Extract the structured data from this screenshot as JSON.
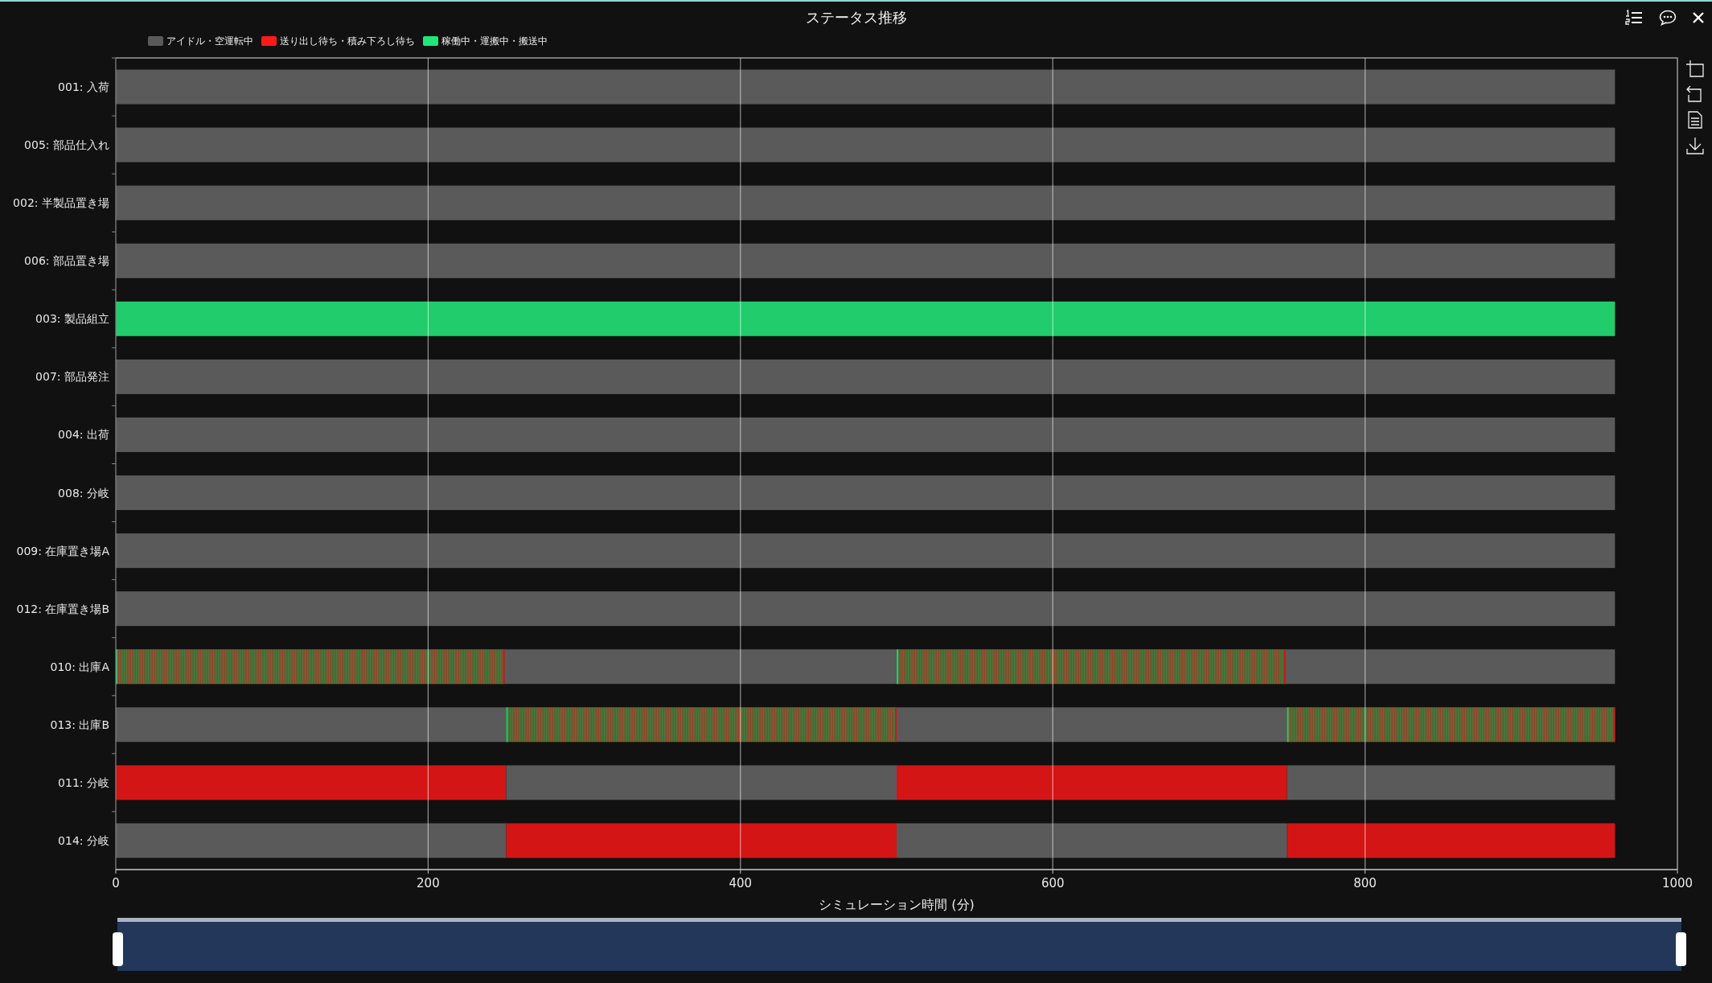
{
  "legend": [
    {
      "label": "アイドル・空運転中",
      "color": "#5a5a5a"
    },
    {
      "label": "送り出し待ち・積み下ろし待ち",
      "color": "#ff1a1a"
    },
    {
      "label": "稼働中・運搬中・搬送中",
      "color": "#1ee87a"
    }
  ],
  "chart": {
    "chart_data": {
      "type": "bar",
      "orientation": "horizontal",
      "stacked": true,
      "grid": true,
      "title": "ステータス推移",
      "xlabel": "シミュレーション時間 (分)",
      "xlim": [
        0,
        1000
      ],
      "xticks": [
        0,
        200,
        400,
        600,
        800,
        1000
      ],
      "categories": [
        "001: 入荷",
        "005: 部品仕入れ",
        "002: 半製品置き場",
        "006: 部品置き場",
        "003: 製品組立",
        "007: 部品発注",
        "004: 出荷",
        "008: 分岐",
        "009: 在庫置き場A",
        "012: 在庫置き場B",
        "010: 出庫A",
        "013: 出庫B",
        "011: 分岐",
        "014: 分岐"
      ],
      "series": [
        {
          "values": [
            960,
            960,
            960,
            960,
            960,
            960,
            960,
            960,
            960,
            960,
            249,
            250,
            250,
            250
          ],
          "colors": [
            "#5a5a5a",
            "#5a5a5a",
            "#5a5a5a",
            "#5a5a5a",
            "#20cc6b",
            "#5a5a5a",
            "#5a5a5a",
            "#5a5a5a",
            "#5a5a5a",
            "#5a5a5a",
            "#5f5b2c",
            "#5a5a5a",
            "#d41515",
            "#5a5a5a"
          ]
        },
        {
          "values": [
            null,
            null,
            null,
            null,
            null,
            null,
            null,
            null,
            null,
            null,
            251,
            250,
            250,
            250
          ],
          "colors": [
            null,
            null,
            null,
            null,
            null,
            null,
            null,
            null,
            null,
            null,
            "#5a5a5a",
            "#5f5b2c",
            "#5a5a5a",
            "#d41515"
          ]
        },
        {
          "values": [
            null,
            null,
            null,
            null,
            null,
            null,
            null,
            null,
            null,
            null,
            249,
            250,
            250,
            250
          ],
          "colors": [
            null,
            null,
            null,
            null,
            null,
            null,
            null,
            null,
            null,
            null,
            "#5f5b2c",
            "#5a5a5a",
            "#d41515",
            "#5a5a5a"
          ]
        },
        {
          "values": [
            null,
            null,
            null,
            null,
            null,
            null,
            null,
            null,
            null,
            null,
            211,
            210,
            210,
            210
          ],
          "colors": [
            null,
            null,
            null,
            null,
            null,
            null,
            null,
            null,
            null,
            null,
            "#5a5a5a",
            "#5f5b2c",
            "#5a5a5a",
            "#d41515"
          ]
        }
      ]
    },
    "rows": [
      {
        "segments": [
          {
            "kind": "idle"
          }
        ]
      },
      {
        "segments": [
          {
            "kind": "idle"
          }
        ]
      },
      {
        "segments": [
          {
            "kind": "idle"
          }
        ]
      },
      {
        "segments": [
          {
            "kind": "idle"
          }
        ]
      },
      {
        "segments": [
          {
            "kind": "working"
          }
        ]
      },
      {
        "segments": [
          {
            "kind": "idle"
          }
        ]
      },
      {
        "segments": [
          {
            "kind": "idle"
          }
        ]
      },
      {
        "segments": [
          {
            "kind": "idle"
          }
        ]
      },
      {
        "segments": [
          {
            "kind": "idle"
          }
        ]
      },
      {
        "segments": [
          {
            "kind": "idle"
          }
        ]
      },
      {
        "segments": [
          {
            "kind": "mixed"
          },
          {
            "kind": "idle"
          },
          {
            "kind": "mixed"
          },
          {
            "kind": "idle"
          }
        ]
      },
      {
        "segments": [
          {
            "kind": "idle"
          },
          {
            "kind": "mixed"
          },
          {
            "kind": "idle"
          },
          {
            "kind": "mixed"
          }
        ]
      },
      {
        "segments": [
          {
            "kind": "waiting"
          },
          {
            "kind": "idle"
          },
          {
            "kind": "waiting"
          },
          {
            "kind": "idle"
          }
        ]
      },
      {
        "segments": [
          {
            "kind": "idle"
          },
          {
            "kind": "waiting"
          },
          {
            "kind": "idle"
          },
          {
            "kind": "waiting"
          }
        ]
      }
    ]
  },
  "range_slider": {
    "level": 1
  }
}
